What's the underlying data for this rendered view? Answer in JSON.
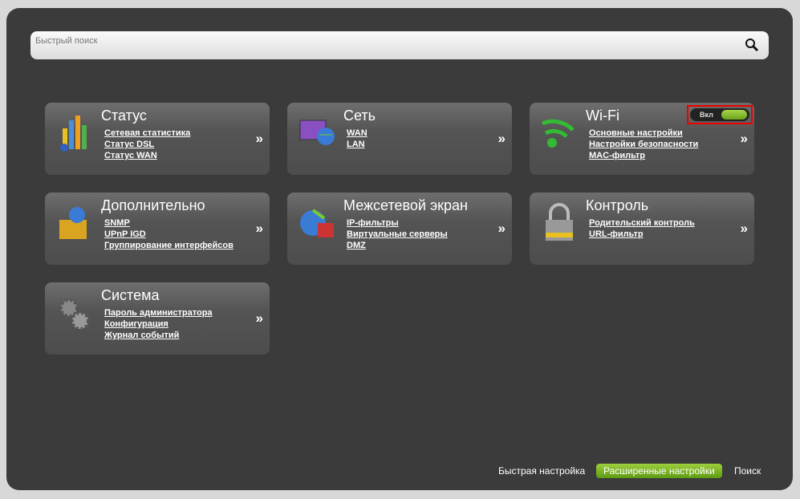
{
  "search": {
    "placeholder": "Быстрый поиск"
  },
  "cards": [
    {
      "title": "Статус",
      "links": [
        "Сетевая статистика",
        "Статус DSL",
        "Статус WAN"
      ]
    },
    {
      "title": "Сеть",
      "links": [
        "WAN",
        "LAN"
      ]
    },
    {
      "title": "Wi-Fi",
      "links": [
        "Основные настройки",
        "Настройки безопасности",
        "MAC-фильтр"
      ],
      "toggle": "Вкл"
    },
    {
      "title": "Дополнительно",
      "links": [
        "SNMP",
        "UPnP IGD",
        "Группирование интерфейсов"
      ]
    },
    {
      "title": "Межсетевой экран",
      "links": [
        "IP-фильтры",
        "Виртуальные серверы",
        "DMZ"
      ]
    },
    {
      "title": "Контроль",
      "links": [
        "Родительский контроль",
        "URL-фильтр"
      ]
    },
    {
      "title": "Система",
      "links": [
        "Пароль администратора",
        "Конфигурация",
        "Журнал событий"
      ]
    }
  ],
  "arrow": "»",
  "footer": {
    "quick": "Быстрая настройка",
    "advanced": "Расширенные настройки",
    "search": "Поиск"
  },
  "colors": {
    "accent": "#7fb829",
    "highlight": "#e00000"
  }
}
